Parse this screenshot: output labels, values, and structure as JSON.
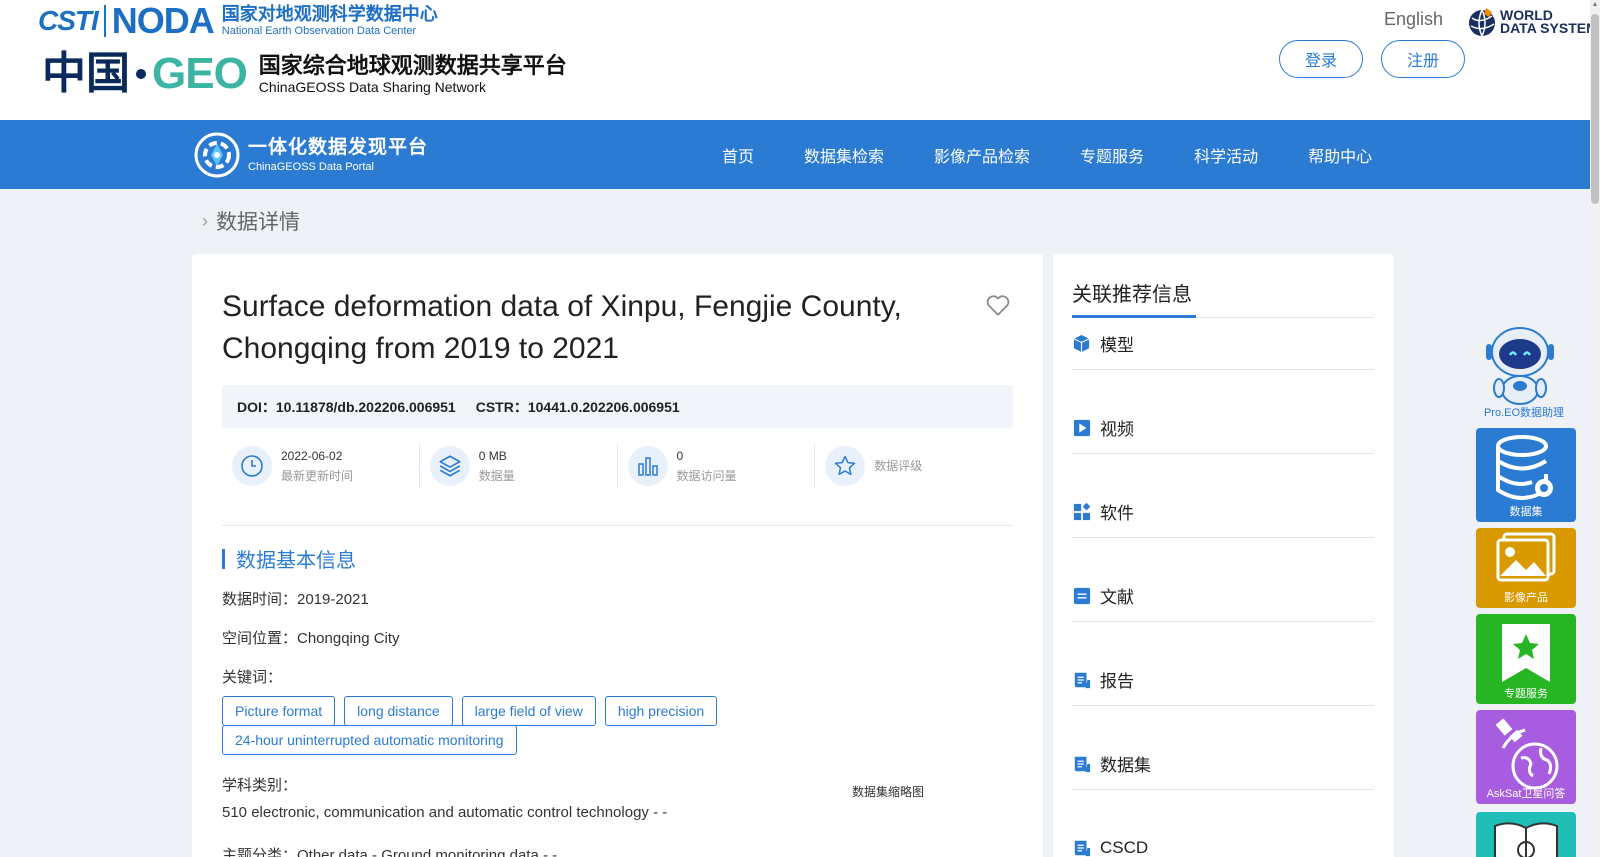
{
  "header": {
    "org_logo_text": "CSTI",
    "noda_logo_text": "NODA",
    "noda_cn": "国家对地观测科学数据中心",
    "noda_en": "National Earth Observation Data Center",
    "china_text": "中国",
    "geo_text": "GEO",
    "geoss_cn": "国家综合地球观测数据共享平台",
    "geoss_en": "ChinaGEOSS Data Sharing Network",
    "language": "English",
    "wds_line1": "WORLD",
    "wds_line2": "DATA SYSTEM",
    "login_label": "登录",
    "register_label": "注册"
  },
  "nav": {
    "portal_cn": "一体化数据发现平台",
    "portal_en": "ChinaGEOSS Data Portal",
    "items": [
      {
        "label": "首页"
      },
      {
        "label": "数据集检索"
      },
      {
        "label": "影像产品检索"
      },
      {
        "label": "专题服务"
      },
      {
        "label": "科学活动"
      },
      {
        "label": "帮助中心"
      }
    ]
  },
  "breadcrumb": {
    "current": "数据详情"
  },
  "dataset": {
    "title": "Surface deformation data of Xinpu, Fengjie County, Chongqing from 2019 to 2021",
    "doi_label": "DOI：",
    "doi": "10.11878/db.202206.006951",
    "cstr_label": "CSTR：",
    "cstr": "10441.0.202206.006951",
    "stats": [
      {
        "value": "2022-06-02",
        "label": "最新更新时间",
        "icon": "clock-icon"
      },
      {
        "value": "0 MB",
        "label": "数据量",
        "icon": "layers-icon"
      },
      {
        "value": "0",
        "label": "数据访问量",
        "icon": "bar-chart-icon"
      },
      {
        "value": "",
        "label": "数据评级",
        "icon": "star-icon"
      }
    ],
    "section_title": "数据基本信息",
    "time_line": "数据时间：2019-2021",
    "location_line": "空间位置：Chongqing City",
    "keywords_label": "关键词：",
    "keywords": [
      "Picture format",
      "long distance",
      "large field of view",
      "high precision",
      "24-hour uninterrupted automatic monitoring"
    ],
    "subject_label": "学科类别：",
    "subject_value": "510 electronic, communication and automatic control technology - -",
    "theme_line": "主题分类：Other data - Ground monitoring data - -",
    "thumbnail_label": "数据集缩略图"
  },
  "related": {
    "title": "关联推荐信息",
    "items": [
      {
        "label": "模型",
        "icon": "cube-icon"
      },
      {
        "label": "视频",
        "icon": "play-icon"
      },
      {
        "label": "软件",
        "icon": "apps-icon"
      },
      {
        "label": "文献",
        "icon": "document-icon"
      },
      {
        "label": "报告",
        "icon": "report-icon"
      },
      {
        "label": "数据集",
        "icon": "report-icon"
      },
      {
        "label": "CSCD",
        "icon": "report-icon"
      }
    ]
  },
  "widgets": {
    "assistant": "Pro.EO数据助理",
    "items": [
      {
        "label": "数据集",
        "color": "#2b7bd3"
      },
      {
        "label": "影像产品",
        "color": "#d99a00"
      },
      {
        "label": "专题服务",
        "color": "#27b523"
      },
      {
        "label": "AskSat卫星问答",
        "color": "#a85de0"
      },
      {
        "label": "",
        "color": "#1fbfb8"
      }
    ]
  },
  "colors": {
    "primary": "#2b7bd3",
    "page_bg": "#eef2f7"
  }
}
